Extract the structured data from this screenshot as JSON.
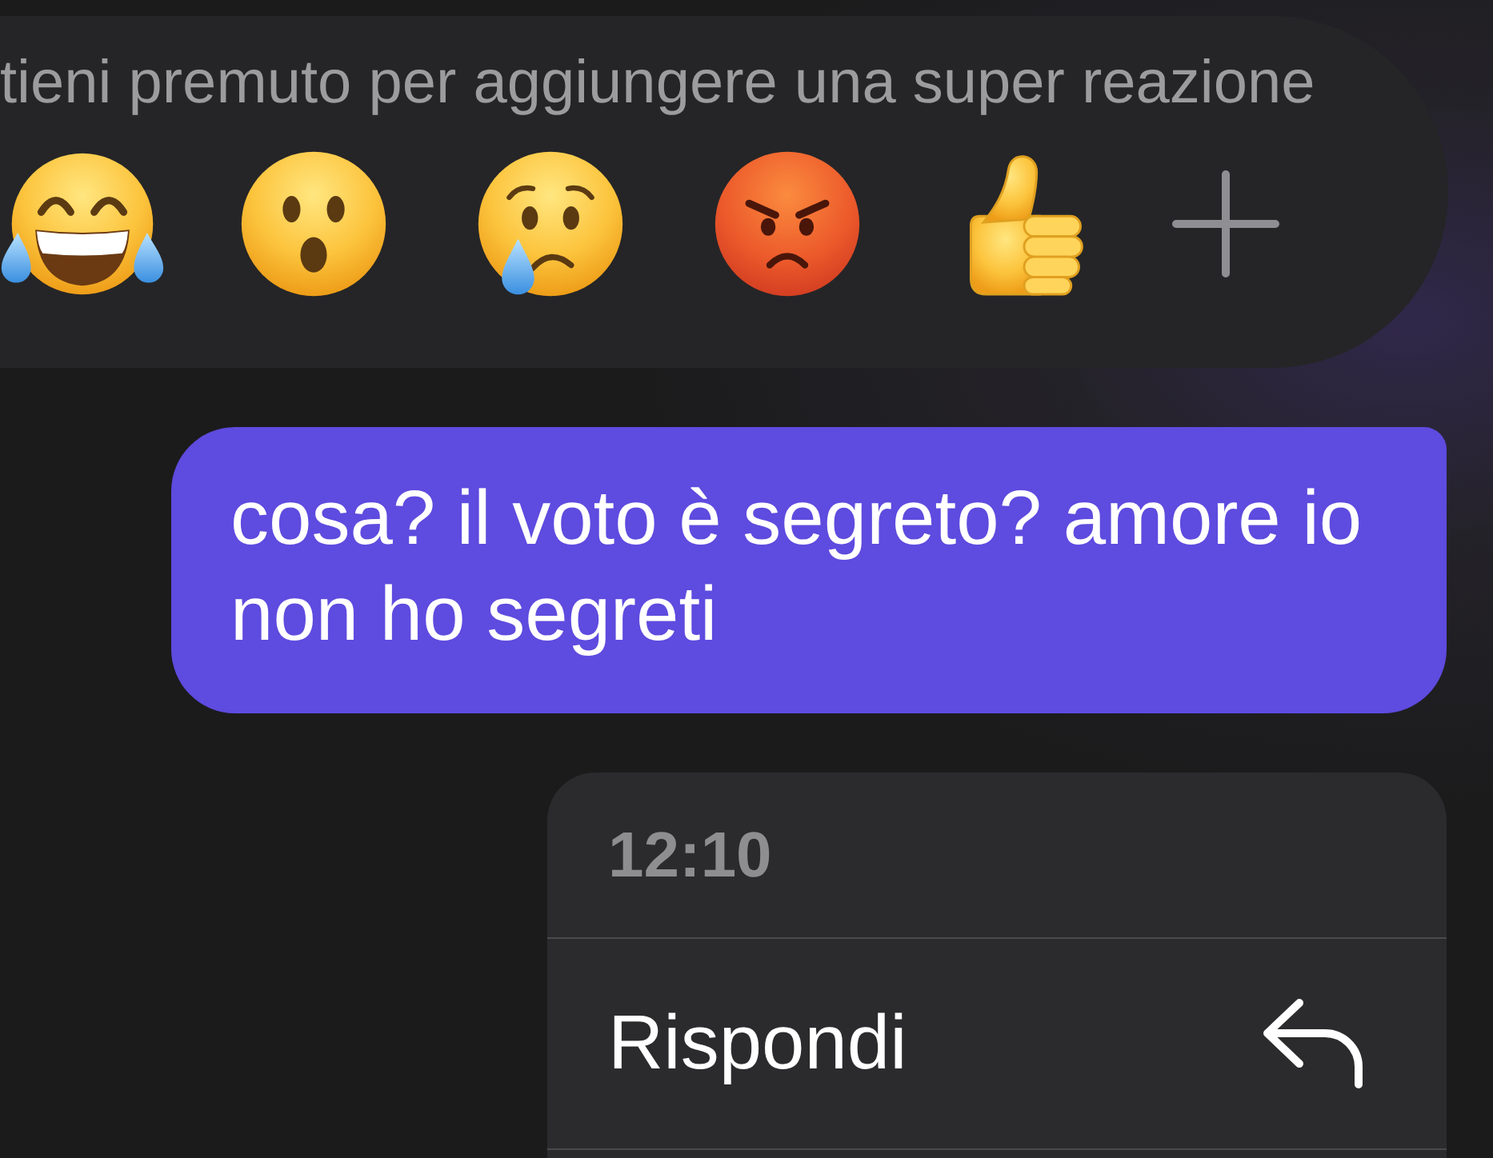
{
  "reaction_bar": {
    "hint": "tieni premuto per aggiungere una super reazione",
    "reactions": [
      {
        "kind": "laughing"
      },
      {
        "kind": "surprised"
      },
      {
        "kind": "crying"
      },
      {
        "kind": "angry"
      },
      {
        "kind": "thumbs_up"
      },
      {
        "kind": "add"
      }
    ]
  },
  "message": {
    "text": "cosa? il voto è segreto? amore io non ho segreti"
  },
  "context_menu": {
    "time": "12:10",
    "items": [
      {
        "label": "Rispondi",
        "kind": "reply"
      }
    ]
  }
}
